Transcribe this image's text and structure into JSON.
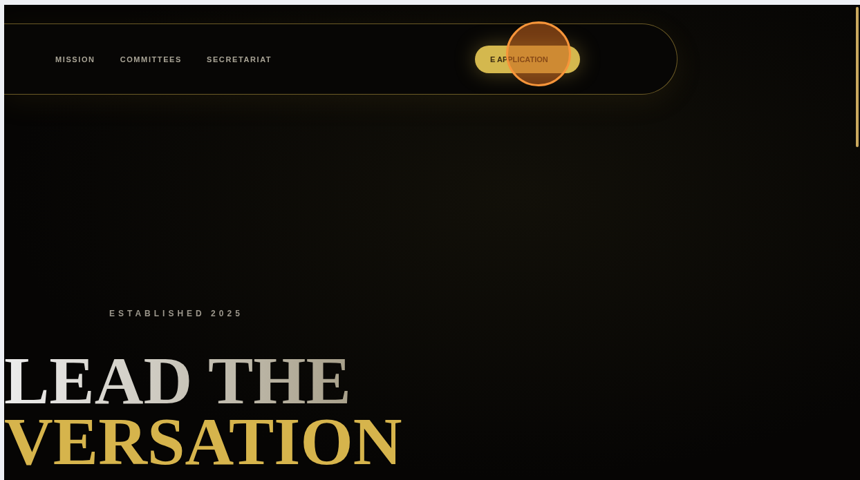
{
  "nav": {
    "links": [
      {
        "label": "MISSION"
      },
      {
        "label": "COMMITTEES"
      },
      {
        "label": "SECRETARIAT"
      }
    ],
    "cta": {
      "label": "E APPLICATION"
    }
  },
  "hero": {
    "eyebrow": "ESTABLISHED 2025",
    "line_1": "LEAD THE",
    "line_2": "VERSATION"
  }
}
